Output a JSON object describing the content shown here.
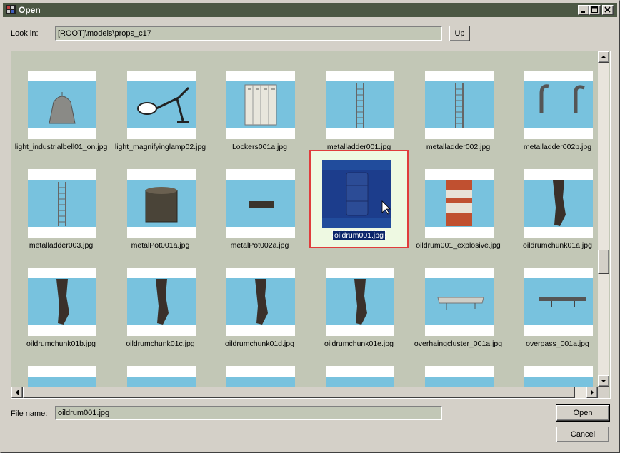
{
  "window": {
    "title": "Open"
  },
  "look_in": {
    "label": "Look in:",
    "path": "[ROOT]\\models\\props_c17",
    "up_label": "Up"
  },
  "files": [
    {
      "name": "light_industrialbell01_on.jpg",
      "icon": "industrial-bell-lamp-icon"
    },
    {
      "name": "light_magnifyinglamp02.jpg",
      "icon": "magnifying-lamp-icon"
    },
    {
      "name": "Lockers001a.jpg",
      "icon": "lockers-icon"
    },
    {
      "name": "metalladder001.jpg",
      "icon": "ladder-icon"
    },
    {
      "name": "metalladder002.jpg",
      "icon": "ladder-icon"
    },
    {
      "name": "metalladder002b.jpg",
      "icon": "ladder-hooks-icon"
    },
    {
      "name": "metalladder003.jpg",
      "icon": "ladder-icon"
    },
    {
      "name": "metalPot001a.jpg",
      "icon": "metal-pot-icon"
    },
    {
      "name": "metalPot002a.jpg",
      "icon": "metal-pot-lid-icon"
    },
    {
      "name": "oildrum001.jpg",
      "icon": "oil-drum-icon",
      "selected": true
    },
    {
      "name": "oildrum001_explosive.jpg",
      "icon": "explosive-drum-icon"
    },
    {
      "name": "oildrumchunk01a.jpg",
      "icon": "drum-chunk-icon"
    },
    {
      "name": "oildrumchunk01b.jpg",
      "icon": "drum-chunk-icon"
    },
    {
      "name": "oildrumchunk01c.jpg",
      "icon": "drum-chunk-icon"
    },
    {
      "name": "oildrumchunk01d.jpg",
      "icon": "drum-chunk-icon"
    },
    {
      "name": "oildrumchunk01e.jpg",
      "icon": "drum-chunk-icon"
    },
    {
      "name": "overhaingcluster_001a.jpg",
      "icon": "overhang-cluster-icon"
    },
    {
      "name": "overpass_001a.jpg",
      "icon": "overpass-icon"
    },
    {
      "name": "",
      "icon": "thumbnail-icon"
    },
    {
      "name": "",
      "icon": "thumbnail-icon"
    },
    {
      "name": "",
      "icon": "thumbnail-icon"
    },
    {
      "name": "",
      "icon": "thumbnail-icon"
    },
    {
      "name": "",
      "icon": "thumbnail-icon"
    },
    {
      "name": "",
      "icon": "thumbnail-icon"
    }
  ],
  "file_name": {
    "label": "File name:",
    "value": "oildrum001.jpg"
  },
  "buttons": {
    "open": "Open",
    "cancel": "Cancel"
  },
  "colors": {
    "titlebar": "#4c5844",
    "panel": "#c2c7b6",
    "thumb_sky": "#78c2de",
    "selection_outline": "#e03c3c"
  }
}
